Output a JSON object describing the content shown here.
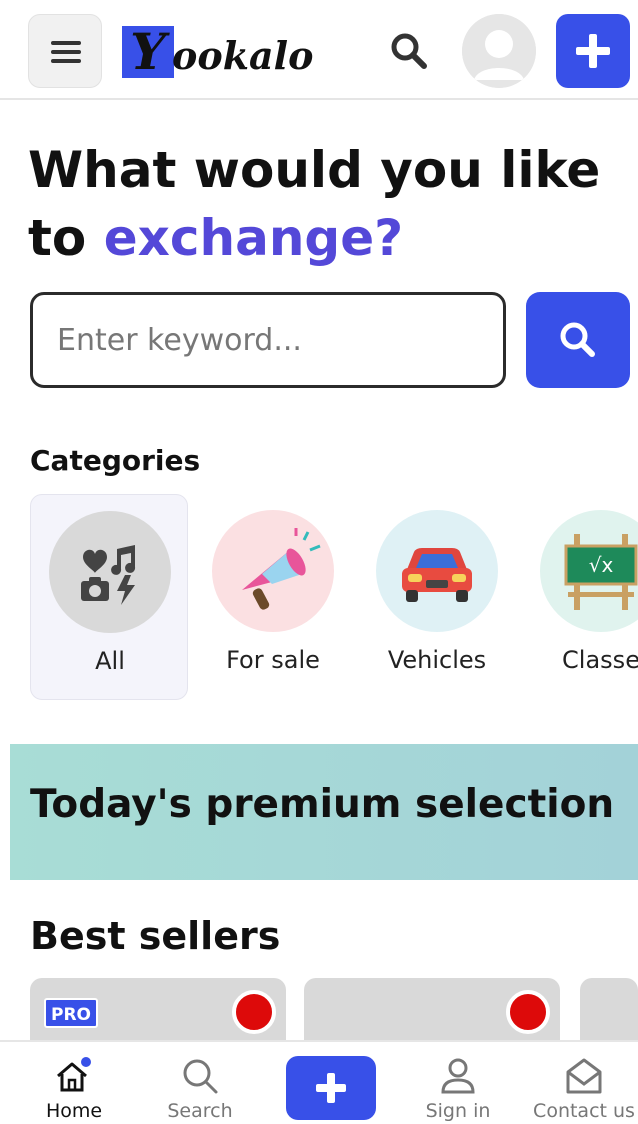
{
  "header": {
    "logo_letter": "Y",
    "logo_rest": "ookalo",
    "menu_icon": "hamburger-menu-icon",
    "search_icon": "search-icon",
    "avatar_icon": "user-avatar-icon",
    "add_icon": "plus-icon"
  },
  "hero": {
    "title_line1": "What would you like",
    "title_prefix": "to",
    "title_accent": "exchange?",
    "accent_color": "#5448d8"
  },
  "search": {
    "placeholder": "Enter keyword...",
    "value": "",
    "button_icon": "search-icon"
  },
  "categories": {
    "title": "Categories",
    "items": [
      {
        "label": "All",
        "icon": "all-categories-icon",
        "selected": true
      },
      {
        "label": "For sale",
        "icon": "megaphone-icon",
        "selected": false
      },
      {
        "label": "Vehicles",
        "icon": "car-icon",
        "selected": false
      },
      {
        "label": "Classe",
        "icon": "chalkboard-icon",
        "selected": false
      }
    ]
  },
  "premium": {
    "title": "Today's premium selection"
  },
  "best_sellers": {
    "title": "Best sellers",
    "cards": [
      {
        "badge": "PRO"
      },
      {
        "badge": ""
      },
      {
        "badge": ""
      }
    ]
  },
  "bottom_nav": {
    "items": [
      {
        "label": "Home",
        "icon": "home-icon",
        "active": true
      },
      {
        "label": "Search",
        "icon": "search-icon",
        "active": false
      },
      {
        "label": "",
        "icon": "plus-icon",
        "active": false
      },
      {
        "label": "Sign in",
        "icon": "user-icon",
        "active": false
      },
      {
        "label": "Contact us",
        "icon": "mail-icon",
        "active": false
      }
    ]
  },
  "colors": {
    "brand": "#3850e8",
    "accent": "#5448d8",
    "record_dot": "#dd0a0a"
  }
}
